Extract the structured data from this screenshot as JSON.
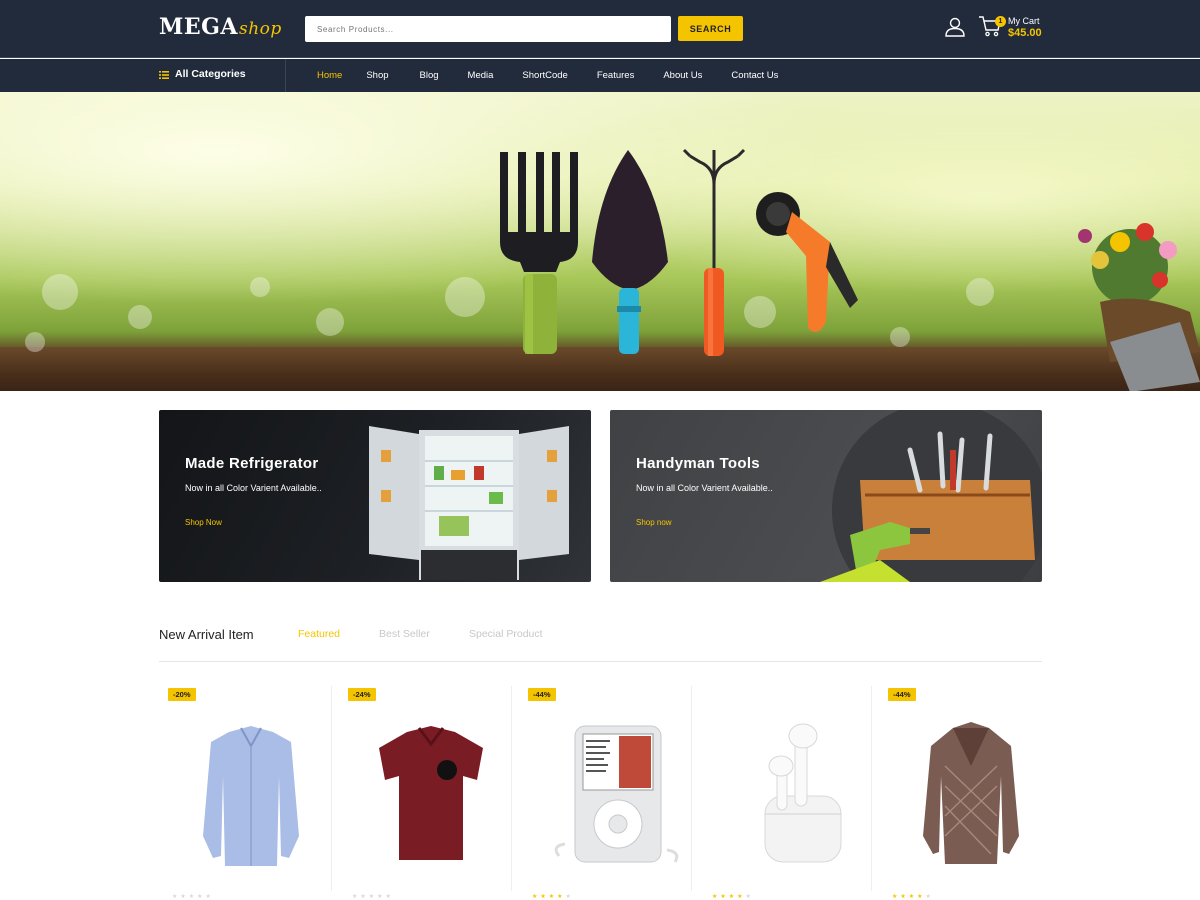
{
  "header": {
    "logo_main": "MEGA",
    "logo_sub": "shop",
    "search_placeholder": "Search Products...",
    "search_button": "SEARCH",
    "cart_badge": "1",
    "cart_label": "My Cart",
    "cart_total": "$45.00"
  },
  "nav": {
    "categories_label": "All Categories",
    "items": [
      {
        "label": "Home",
        "active": true
      },
      {
        "label": "Shop"
      },
      {
        "label": "Blog"
      },
      {
        "label": "Media"
      },
      {
        "label": "ShortCode"
      },
      {
        "label": "Features"
      },
      {
        "label": "About Us"
      },
      {
        "label": "Contact Us"
      }
    ]
  },
  "banners": [
    {
      "title": "Made Refrigerator",
      "subtitle": "Now in all Color Varient Available..",
      "link": "Shop Now"
    },
    {
      "title": "Handyman Tools",
      "subtitle": "Now in all Color Varient Available..",
      "link": "Shop now"
    }
  ],
  "products_section": {
    "title": "New Arrival Item",
    "tabs": [
      "Featured",
      "Best Seller",
      "Special Product"
    ],
    "active_tab": "Featured"
  },
  "products": [
    {
      "badge": "-20%",
      "image": "dress-shirt",
      "rating": 0
    },
    {
      "badge": "-24%",
      "image": "polo-shirt",
      "rating": 0
    },
    {
      "badge": "-44%",
      "image": "ipod",
      "rating": 4
    },
    {
      "badge": "",
      "image": "earbuds",
      "rating": 4
    },
    {
      "badge": "-44%",
      "image": "cardigan",
      "rating": 4
    }
  ],
  "colors": {
    "header_bg": "#222b3c",
    "accent": "#f5c400"
  }
}
